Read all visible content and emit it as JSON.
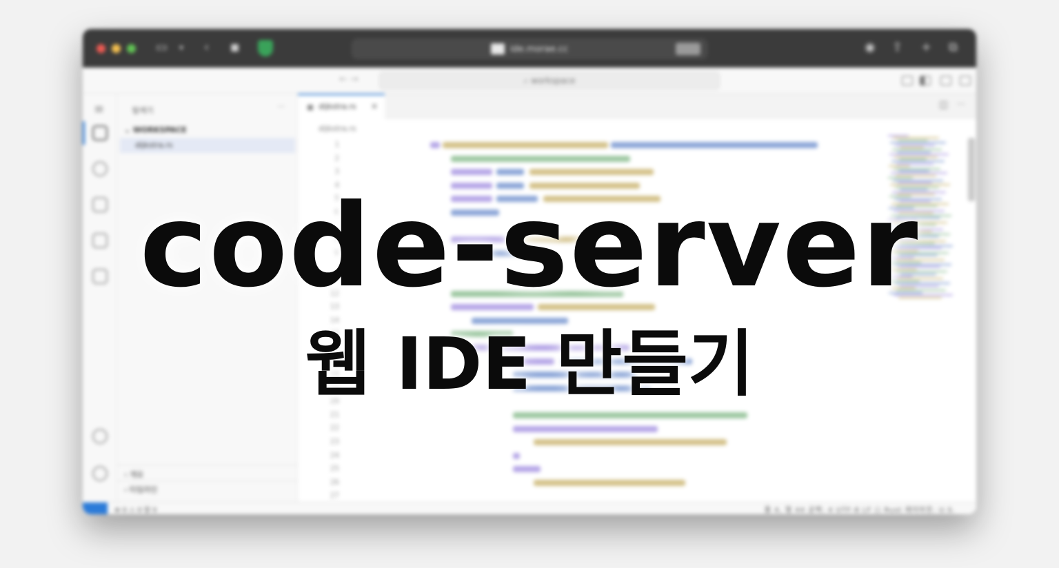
{
  "headline": "code-server",
  "subheadline": "웹 IDE 만들기",
  "browser": {
    "url": "ide.morae.cc"
  },
  "command_center": {
    "search_text": "workspace"
  },
  "explorer": {
    "title": "탐색기",
    "section": "WORKSPACE",
    "files": [
      "dijkstra.rs"
    ],
    "outline_label": "개요",
    "timeline_label": "타임라인"
  },
  "editor": {
    "tab_label": "dijkstra.rs",
    "breadcrumb": "dijkstra.rs",
    "line_numbers": [
      "1",
      "2",
      "3",
      "4",
      "5",
      "6",
      "",
      "8",
      "9",
      "",
      "",
      "12",
      "13",
      "14",
      "15",
      "16",
      "17",
      "18",
      "19",
      "20",
      "21",
      "22",
      "23",
      "24",
      "25",
      "26",
      "27"
    ]
  },
  "statusbar": {
    "left": "⊗ 0 ⚠ 0   알 0",
    "right": "줄 4, 열 44   공백: 4   UTF-8   LF   ⟨⟩ Rust   레이아웃: U.S."
  },
  "colors": {
    "titlebar": "#3b3b3b",
    "accent": "#2b7bd9",
    "keyword": "#7a5fd3",
    "function": "#b0902a",
    "comment": "#4f9a56",
    "variable": "#2f5fb8"
  }
}
